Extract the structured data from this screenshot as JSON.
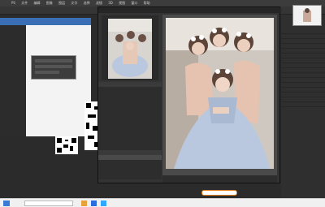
{
  "ps": {
    "menu": [
      "PS",
      "文件",
      "编辑",
      "图像",
      "图层",
      "文字",
      "选择",
      "滤镜",
      "3D",
      "视图",
      "窗口",
      "帮助"
    ],
    "right_rows": [
      "",
      "",
      "",
      "",
      "",
      "",
      "",
      "",
      "",
      "",
      "",
      "",
      "",
      "",
      "",
      ""
    ]
  },
  "chat": {
    "title": "",
    "messages": [
      {
        "user": "",
        "text": ""
      },
      {
        "user": "",
        "text": ""
      },
      {
        "user": "",
        "text": ""
      },
      {
        "user": "",
        "text": ""
      },
      {
        "user": "",
        "text": ""
      },
      {
        "user": "",
        "text": ""
      }
    ]
  },
  "lr": {
    "panel_header": "",
    "tree_items": [
      "",
      "",
      "",
      "",
      "",
      "",
      "",
      "",
      "",
      "",
      "",
      "",
      "",
      "",
      "",
      ""
    ],
    "selected_index": 11,
    "lower_header": "",
    "lower_items": [
      "",
      "",
      "",
      "",
      ""
    ],
    "bottom_text": "",
    "mid_buttons": [
      "",
      ""
    ]
  },
  "taskbar": {
    "search_placeholder": "",
    "chip": ""
  },
  "watermark": "",
  "colors": {
    "accent": "#3a6fb6",
    "dress": "#b9c8de",
    "skin": "#e9c9b4"
  }
}
